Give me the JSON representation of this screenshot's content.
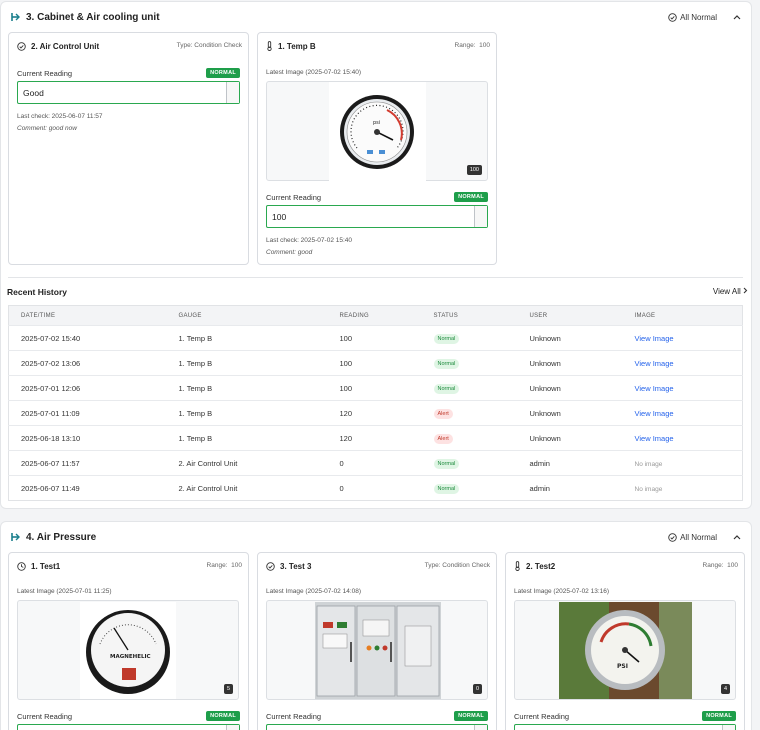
{
  "sections": [
    {
      "title": "3. Cabinet & Air cooling unit",
      "status": "All Normal"
    },
    {
      "title": "4. Air Pressure",
      "status": "All Normal"
    }
  ],
  "cabinet_cards": {
    "air_control": {
      "title": "2. Air Control Unit",
      "type_label": "Type: Condition Check",
      "reading_label": "Current Reading",
      "badge": "NORMAL",
      "value": "Good",
      "last_check": "Last check: 2025-06-07 11:57",
      "comment": "Comment: good now"
    },
    "temp_b": {
      "title": "1. Temp B",
      "range_label": "Range:",
      "range_value": "100",
      "latest_image": "Latest Image (2025-07-02 15:40)",
      "image_count": "100",
      "reading_label": "Current Reading",
      "badge": "NORMAL",
      "value": "100",
      "last_check": "Last check: 2025-07-02 15:40",
      "comment": "Comment: good"
    }
  },
  "history": {
    "title": "Recent History",
    "view_all": "View All",
    "columns": [
      "DATE/TIME",
      "GAUGE",
      "READING",
      "STATUS",
      "USER",
      "IMAGE"
    ],
    "rows": [
      {
        "datetime": "2025-07-02 15:40",
        "gauge": "1. Temp B",
        "reading": "100",
        "status": "Normal",
        "user": "Unknown",
        "image": "View Image"
      },
      {
        "datetime": "2025-07-02 13:06",
        "gauge": "1. Temp B",
        "reading": "100",
        "status": "Normal",
        "user": "Unknown",
        "image": "View Image"
      },
      {
        "datetime": "2025-07-01 12:06",
        "gauge": "1. Temp B",
        "reading": "100",
        "status": "Normal",
        "user": "Unknown",
        "image": "View Image"
      },
      {
        "datetime": "2025-07-01 11:09",
        "gauge": "1. Temp B",
        "reading": "120",
        "status": "Alert",
        "user": "Unknown",
        "image": "View Image"
      },
      {
        "datetime": "2025-06-18 13:10",
        "gauge": "1. Temp B",
        "reading": "120",
        "status": "Alert",
        "user": "Unknown",
        "image": "View Image"
      },
      {
        "datetime": "2025-06-07 11:57",
        "gauge": "2. Air Control Unit",
        "reading": "0",
        "status": "Normal",
        "user": "admin",
        "image": "No image"
      },
      {
        "datetime": "2025-06-07 11:49",
        "gauge": "2. Air Control Unit",
        "reading": "0",
        "status": "Normal",
        "user": "admin",
        "image": "No image"
      }
    ]
  },
  "pressure_cards": {
    "test1": {
      "title": "1. Test1",
      "range_label": "Range:",
      "range_value": "100",
      "latest_image": "Latest Image (2025-07-01 11:25)",
      "image_count": "5",
      "reading_label": "Current Reading",
      "badge": "NORMAL"
    },
    "test3": {
      "title": "3. Test 3",
      "type_label": "Type: Condition Check",
      "latest_image": "Latest Image (2025-07-02 14:08)",
      "image_count": "0",
      "reading_label": "Current Reading",
      "badge": "NORMAL"
    },
    "test2": {
      "title": "2. Test2",
      "range_label": "Range:",
      "range_value": "100",
      "latest_image": "Latest Image (2025-07-02 13:16)",
      "image_count": "4",
      "reading_label": "Current Reading",
      "badge": "NORMAL"
    }
  },
  "gauge_images": {
    "temp_b_gauge_text": "psi",
    "test1_brand": "MAGNEHELIC",
    "test2_text": "PSI"
  },
  "colors": {
    "accent_green": "#1e9e4a",
    "link_blue": "#2563eb",
    "alert_red": "#c0392b"
  },
  "icons": {
    "section": "gauge-teal-icon",
    "status": "check-circle-icon",
    "collapse": "chevron-up-icon",
    "condition": "check-circle-icon",
    "temperature": "thermometer-icon",
    "pressure": "clock-icon"
  }
}
